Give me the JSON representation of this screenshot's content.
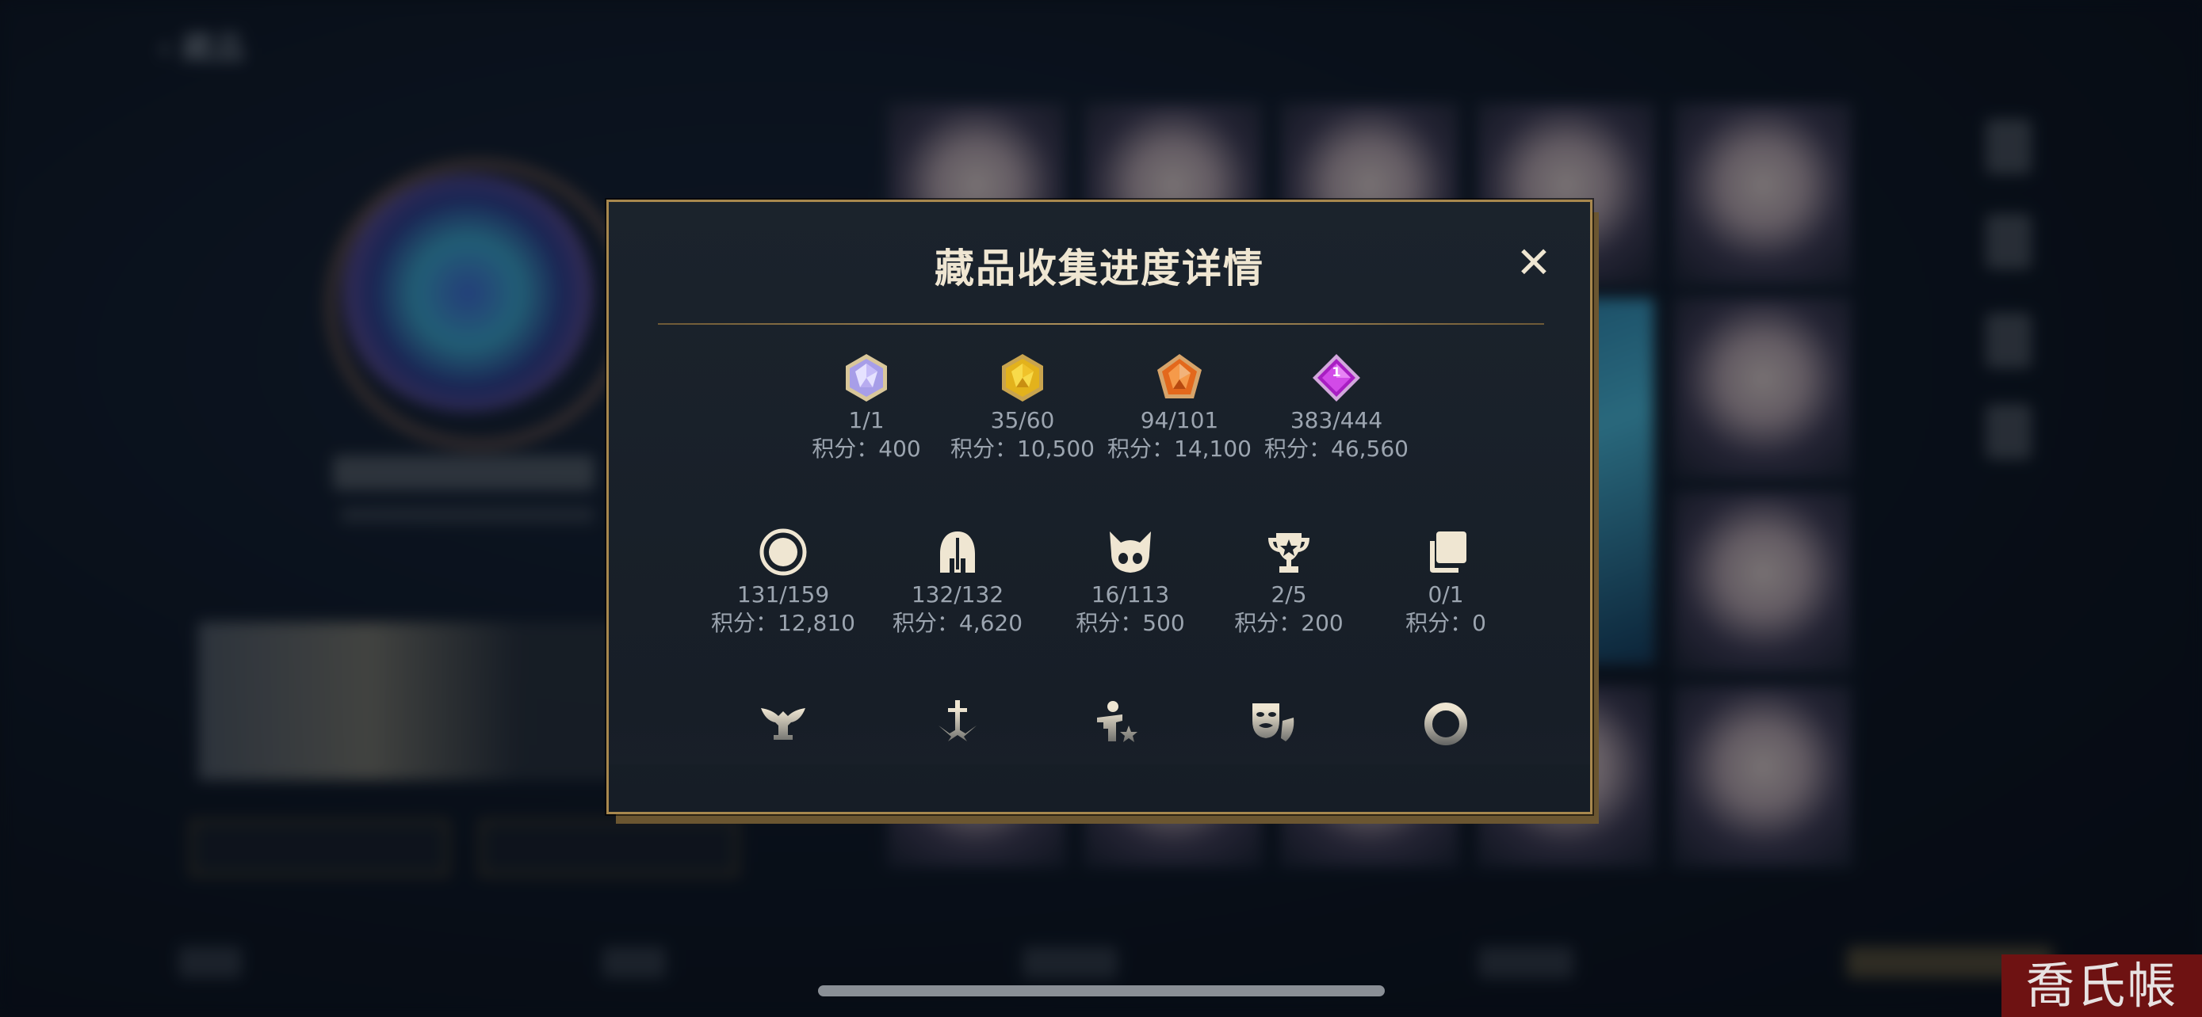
{
  "background": {
    "back_label": "‹ 藏品"
  },
  "dialog": {
    "title": "藏品收集进度详情",
    "close_glyph": "✕",
    "rows": [
      [
        {
          "icon": "crystal-white-icon",
          "count": "1/1",
          "score": "积分：400"
        },
        {
          "icon": "crystal-gold-icon",
          "count": "35/60",
          "score": "积分：10,500"
        },
        {
          "icon": "crystal-orange-icon",
          "count": "94/101",
          "score": "积分：14,100"
        },
        {
          "icon": "crystal-purple-icon",
          "count": "383/444",
          "score": "积分：46,560"
        }
      ],
      [
        {
          "icon": "summoner-icon",
          "count": "131/159",
          "score": "积分：12,810"
        },
        {
          "icon": "helmet-icon",
          "count": "132/132",
          "score": "积分：4,620"
        },
        {
          "icon": "ward-icon",
          "count": "16/113",
          "score": "积分：500"
        },
        {
          "icon": "trophy-icon",
          "count": "2/5",
          "score": "积分：200"
        },
        {
          "icon": "stacked-cards-icon",
          "count": "0/1",
          "score": "积分：0"
        }
      ],
      [
        {
          "icon": "winged-emblem-icon"
        },
        {
          "icon": "sword-emblem-icon"
        },
        {
          "icon": "champion-star-icon"
        },
        {
          "icon": "theater-mask-icon"
        },
        {
          "icon": "ring-icon"
        }
      ]
    ]
  },
  "watermark": "喬氏帳號",
  "colors": {
    "gold_border": "#a8884e",
    "title_text": "#efe6d2",
    "value_text": "#9ca5b0",
    "icon_cream": "#efe6d2"
  }
}
